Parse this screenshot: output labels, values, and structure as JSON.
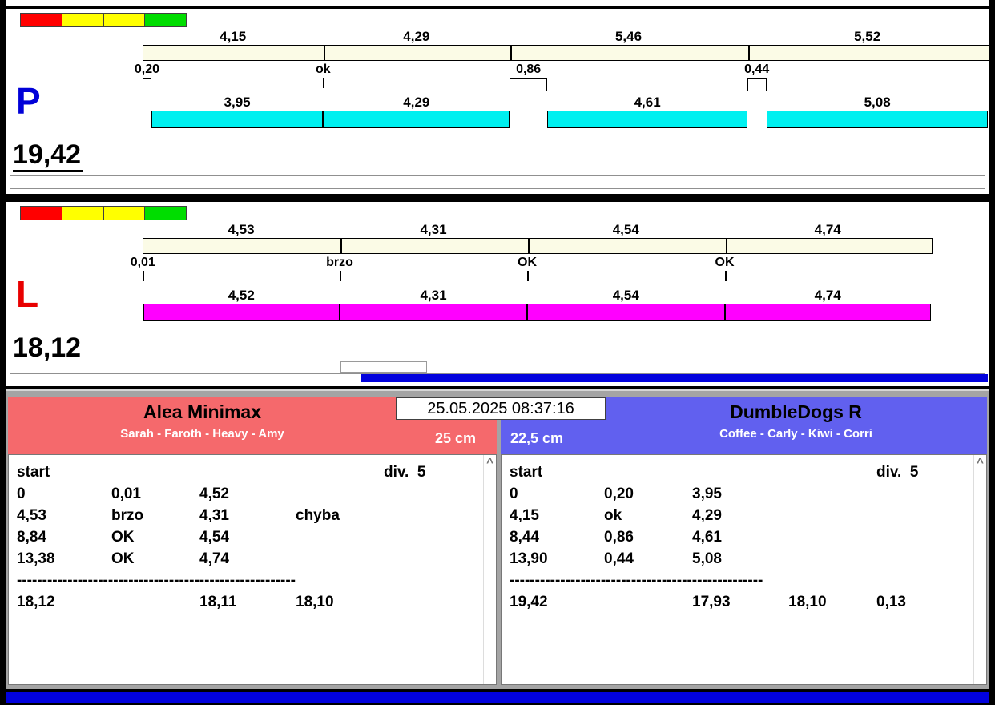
{
  "header": {
    "timestamp": "25.05.2025 08:37:16"
  },
  "progress_bar_color": "#0202dd",
  "bottom_bar_color": "#0202dd",
  "lanes": [
    {
      "letter": "P",
      "letter_color": "#0000d8",
      "total": "19,42",
      "traffic_lights": [
        "#ff0000",
        "#ffff00",
        "#ffff00",
        "#00dd00"
      ],
      "split_times": [
        "4,15",
        "4,29",
        "5,46",
        "5,52"
      ],
      "crossover_marks": [
        "0,20",
        "ok",
        "0,86",
        "0,44"
      ],
      "dog_times": [
        "3,95",
        "4,29",
        "4,61",
        "5,08"
      ],
      "bar_color": "#00f0f0"
    },
    {
      "letter": "L",
      "letter_color": "#e80000",
      "total": "18,12",
      "traffic_lights": [
        "#ff0000",
        "#ffff00",
        "#ffff00",
        "#00dd00"
      ],
      "split_times": [
        "4,53",
        "4,31",
        "4,54",
        "4,74"
      ],
      "crossover_marks": [
        "0,01",
        "brzo",
        "OK",
        "OK"
      ],
      "dog_times": [
        "4,52",
        "4,31",
        "4,54",
        "4,74"
      ],
      "bar_color": "#ff00ff"
    }
  ],
  "teams": [
    {
      "name": "Alea Minimax",
      "dogs": "Sarah - Faroth - Heavy - Amy",
      "height": "25 cm",
      "header_color": "#f5696c",
      "table": {
        "start_label": "start",
        "division": "div.  5",
        "rows": [
          [
            "0",
            "0,01",
            "4,52",
            ""
          ],
          [
            "4,53",
            "brzo",
            "4,31",
            "chyba"
          ],
          [
            "8,84",
            "OK",
            "4,54",
            ""
          ],
          [
            "13,38",
            "OK",
            "4,74",
            ""
          ]
        ],
        "separator": "-------------------------------------------------------",
        "totals": [
          "18,12",
          "",
          "18,11",
          "18,10",
          ""
        ]
      }
    },
    {
      "name": "DumbleDogs R",
      "dogs": "Coffee - Carly - Kiwi - Corri",
      "height": "22,5 cm",
      "header_color": "#6160ef",
      "table": {
        "start_label": "start",
        "division": "div.  5",
        "rows": [
          [
            "0",
            "0,20",
            "3,95",
            ""
          ],
          [
            "4,15",
            "ok",
            "4,29",
            ""
          ],
          [
            "8,44",
            "0,86",
            "4,61",
            ""
          ],
          [
            "13,90",
            "0,44",
            "5,08",
            ""
          ]
        ],
        "separator": "--------------------------------------------------",
        "totals": [
          "19,42",
          "",
          "17,93",
          "18,10",
          "0,13"
        ]
      }
    }
  ]
}
